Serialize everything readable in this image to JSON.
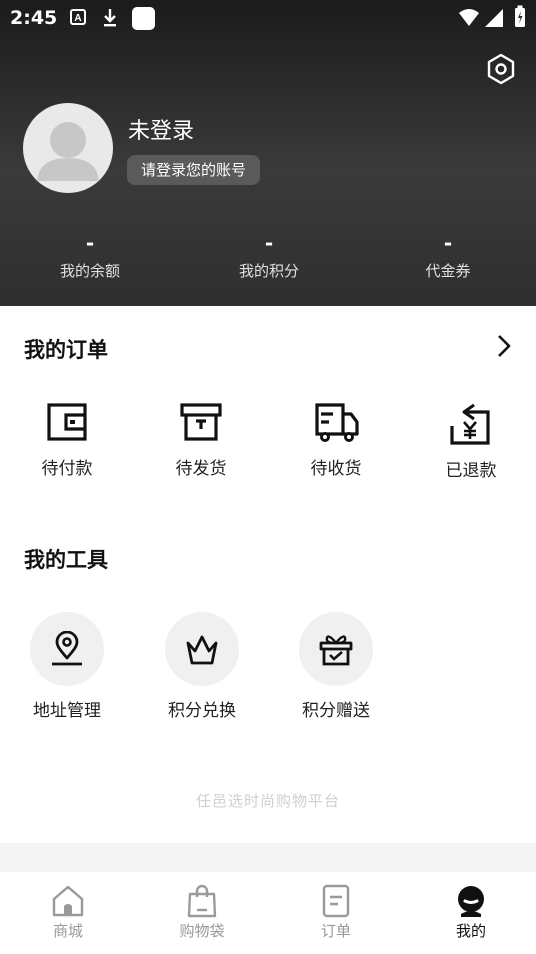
{
  "status_bar": {
    "time": "2:45"
  },
  "profile": {
    "username": "未登录",
    "login_prompt": "请登录您的账号"
  },
  "stats": [
    {
      "value": "-",
      "label": "我的余额"
    },
    {
      "value": "-",
      "label": "我的积分"
    },
    {
      "value": "-",
      "label": "代金券"
    }
  ],
  "orders": {
    "title": "我的订单",
    "items": [
      {
        "label": "待付款",
        "icon": "wallet-icon"
      },
      {
        "label": "待发货",
        "icon": "box-icon"
      },
      {
        "label": "待收货",
        "icon": "delivery-truck-icon"
      },
      {
        "label": "已退款",
        "icon": "refund-yen-icon"
      }
    ]
  },
  "tools": {
    "title": "我的工具",
    "items": [
      {
        "label": "地址管理",
        "icon": "location-pin-icon"
      },
      {
        "label": "积分兑换",
        "icon": "basket-icon"
      },
      {
        "label": "积分赠送",
        "icon": "gift-icon"
      }
    ]
  },
  "footer_text": "任邑选时尚购物平台",
  "tabs": [
    {
      "label": "商城",
      "icon": "home-icon",
      "active": false
    },
    {
      "label": "购物袋",
      "icon": "shopping-bag-icon",
      "active": false
    },
    {
      "label": "订单",
      "icon": "order-doc-icon",
      "active": false
    },
    {
      "label": "我的",
      "icon": "profile-face-icon",
      "active": true
    }
  ],
  "colors": {
    "header_dark": "#1b1b1b",
    "active_tab": "#111111",
    "inactive_tab": "#9a9a9a"
  }
}
